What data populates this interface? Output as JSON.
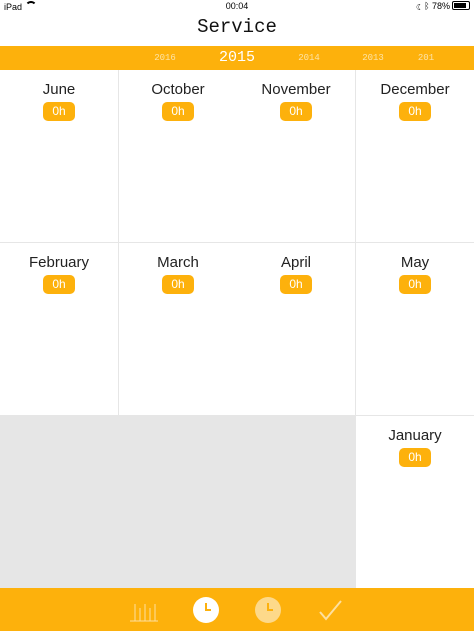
{
  "status_bar": {
    "device": "iPad",
    "time": "00:04",
    "battery": "78%"
  },
  "header": {
    "title": "Service"
  },
  "years": {
    "items": [
      "2016",
      "2015",
      "2014",
      "2013",
      "201"
    ],
    "selected_index": 1
  },
  "months": [
    {
      "name": "June",
      "hours": "0h"
    },
    {
      "name": "October",
      "hours": "0h"
    },
    {
      "name": "November",
      "hours": "0h"
    },
    {
      "name": "December",
      "hours": "0h"
    },
    {
      "name": "February",
      "hours": "0h"
    },
    {
      "name": "March",
      "hours": "0h"
    },
    {
      "name": "April",
      "hours": "0h"
    },
    {
      "name": "May",
      "hours": "0h"
    },
    {
      "name": "January",
      "hours": "0h"
    }
  ],
  "tab_bar": {
    "tabs": [
      {
        "icon": "bar-chart-icon",
        "selected": false
      },
      {
        "icon": "clock-icon",
        "selected": true
      },
      {
        "icon": "clock-icon",
        "selected": false
      },
      {
        "icon": "checkmark-icon",
        "selected": false
      }
    ]
  },
  "colors": {
    "accent": "#fdb10c",
    "grid_line": "#e6e6e6",
    "empty_area": "#e6e6e6"
  }
}
